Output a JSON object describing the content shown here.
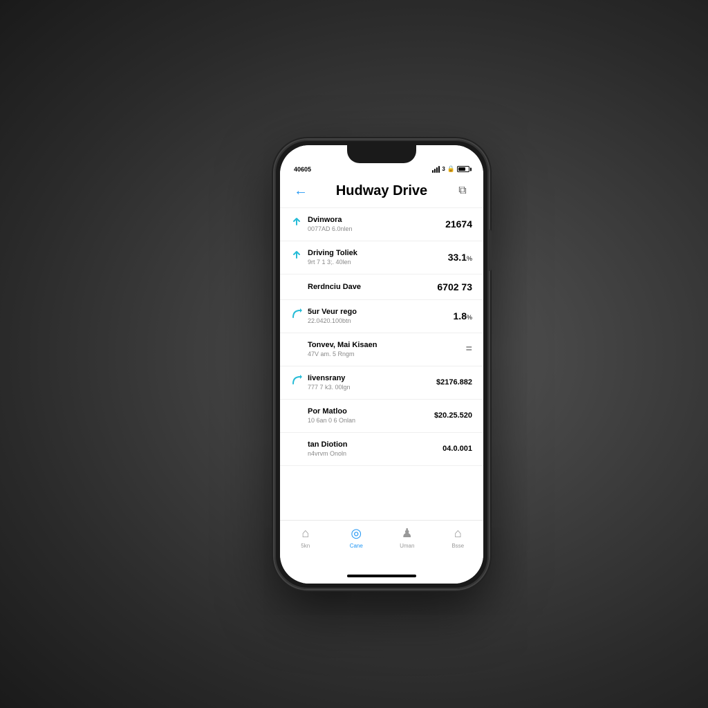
{
  "scene": {
    "background": "#3a3a3a"
  },
  "status_bar": {
    "time": "40605",
    "signal": "3",
    "battery": "70"
  },
  "header": {
    "title_part1": "Hudway",
    "title_part2": "Drive",
    "back_label": "←",
    "share_label": "⎋"
  },
  "list_items": [
    {
      "id": "item1",
      "icon": "arrow-up-icon",
      "title": "Dvinwora",
      "subtitle": "0077AD 6.0nlen",
      "value": "21674",
      "value_suffix": ""
    },
    {
      "id": "item2",
      "icon": "arrow-up-icon",
      "title": "Driving Toliek",
      "subtitle": "9rt 7 1 3;. 40len",
      "value": "33.1",
      "value_suffix": "%"
    },
    {
      "id": "item3",
      "icon": "none",
      "title": "Rerdnciu Dave",
      "subtitle": "",
      "value": "6702 73",
      "value_suffix": ""
    },
    {
      "id": "item4",
      "icon": "arc-icon",
      "title": "5ur Veur rego",
      "subtitle": "22.0420.100btn",
      "value": "1.8",
      "value_suffix": "%"
    },
    {
      "id": "item5",
      "icon": "none",
      "title": "Tonvev, Mai Kisaen",
      "subtitle": "47V am. 5 Rngm",
      "value": "=",
      "value_suffix": ""
    },
    {
      "id": "item6",
      "icon": "arc-icon",
      "title": "Iivensrany",
      "subtitle": "777 7 k3. 00lgn",
      "value": "$2176.882",
      "value_suffix": ""
    },
    {
      "id": "item7",
      "icon": "none",
      "title": "Por Matloo",
      "subtitle": "10 6an 0 6 Onlan",
      "value": "$20.25.520",
      "value_suffix": ""
    },
    {
      "id": "item8",
      "icon": "none",
      "title": "tan Diotion",
      "subtitle": "n4vrvm Onoln",
      "value": "04.0.001",
      "value_suffix": ""
    }
  ],
  "tab_bar": {
    "items": [
      {
        "id": "tab-scan",
        "icon": "∧",
        "label": "5kn",
        "active": false
      },
      {
        "id": "tab-cane",
        "icon": "⊙",
        "label": "Cane",
        "active": true
      },
      {
        "id": "tab-uman",
        "icon": "♟",
        "label": "Uman",
        "active": false
      },
      {
        "id": "tab-bsse",
        "icon": "∧",
        "label": "Bsse",
        "active": false
      }
    ]
  }
}
